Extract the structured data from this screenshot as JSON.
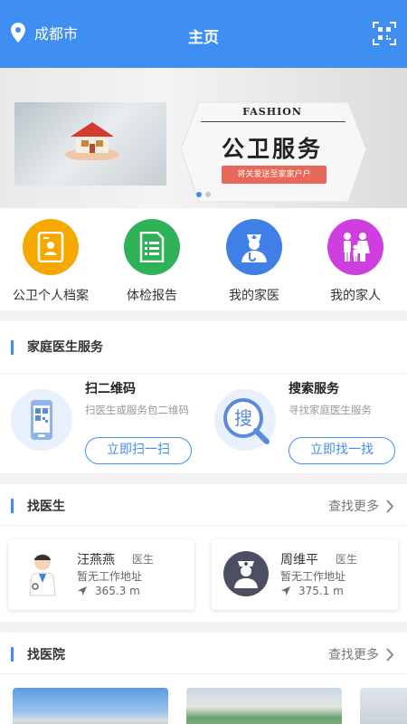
{
  "header": {
    "location": "成都市",
    "title": "主页"
  },
  "banner": {
    "fashion_text": "FASHION",
    "title": "公卫服务",
    "slogan": "将关爱送至家家户户"
  },
  "quick_actions": [
    {
      "label": "公卫个人档案",
      "icon": "profile-card-icon",
      "color": "#f5a800"
    },
    {
      "label": "体检报告",
      "icon": "report-list-icon",
      "color": "#2fb157"
    },
    {
      "label": "我的家医",
      "icon": "doctor-icon",
      "color": "#3f7fe6"
    },
    {
      "label": "我的家人",
      "icon": "family-icon",
      "color": "#cf3fe0"
    }
  ],
  "family_doctor": {
    "title": "家庭医生服务",
    "scan": {
      "title": "扫二维码",
      "desc": "扫医生或服务包二维码",
      "button": "立即扫一扫"
    },
    "search": {
      "title": "搜索服务",
      "desc": "寻找家庭医生服务",
      "button": "立即找一找",
      "icon_char": "搜"
    }
  },
  "find_doctor": {
    "title": "找医生",
    "more": "查找更多",
    "doctors": [
      {
        "name": "汪燕燕",
        "role": "医生",
        "address": "暂无工作地址",
        "distance": "365.3 m"
      },
      {
        "name": "周维平",
        "role": "医生",
        "address": "暂无工作地址",
        "distance": "375.1 m"
      }
    ]
  },
  "find_hospital": {
    "title": "找医院",
    "more": "查找更多"
  },
  "colors": {
    "primary": "#3f8ef2"
  }
}
